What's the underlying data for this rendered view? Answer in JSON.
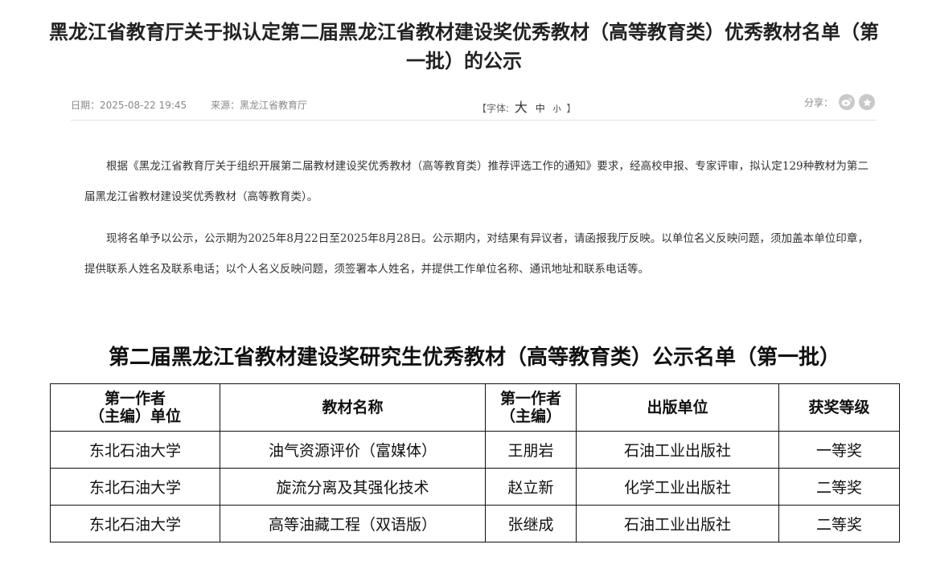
{
  "article": {
    "title": "黑龙江省教育厅关于拟认定第二届黑龙江省教材建设奖优秀教材（高等教育类）优秀教材名单（第一批）的公示"
  },
  "meta": {
    "date": "日期：2025-08-22 19:45",
    "source": "来源：黑龙江省教育厅",
    "font_label_open": "【字体:",
    "font_big": "大",
    "font_mid": "中",
    "font_small": "小",
    "font_label_close": "】",
    "share_label": "分享：",
    "share_icons": [
      "weibo-icon",
      "favorite-icon"
    ]
  },
  "body": {
    "paragraph_1": "根据《黑龙江省教育厅关于组织开展第二届教材建设奖优秀教材（高等教育类）推荐评选工作的通知》要求，经高校申报、专家评审，拟认定129种教材为第二届黑龙江省教材建设奖优秀教材（高等教育类）。",
    "paragraph_2": "现将名单予以公示，公示期为2025年8月22日至2025年8月28日。公示期内，对结果有异议者，请函报我厅反映。以单位名义反映问题，须加盖本单位印章，提供联系人姓名及联系电话；以个人名义反映问题，须签署本人姓名，并提供工作单位名称、通讯地址和联系电话等。"
  },
  "table": {
    "title": "第二届黑龙江省教材建设奖研究生优秀教材（高等教育类）公示名单（第一批）",
    "headers": [
      "第一作者\n（主编）单位",
      "教材名称",
      "第一作者\n（主编）",
      "出版单位",
      "获奖等级"
    ],
    "rows": [
      [
        "东北石油大学",
        "油气资源评价（富媒体）",
        "王朋岩",
        "石油工业出版社",
        "一等奖"
      ],
      [
        "东北石油大学",
        "旋流分离及其强化技术",
        "赵立新",
        "化学工业出版社",
        "二等奖"
      ],
      [
        "东北石油大学",
        "高等油藏工程（双语版）",
        "张继成",
        "石油工业出版社",
        "二等奖"
      ]
    ]
  }
}
